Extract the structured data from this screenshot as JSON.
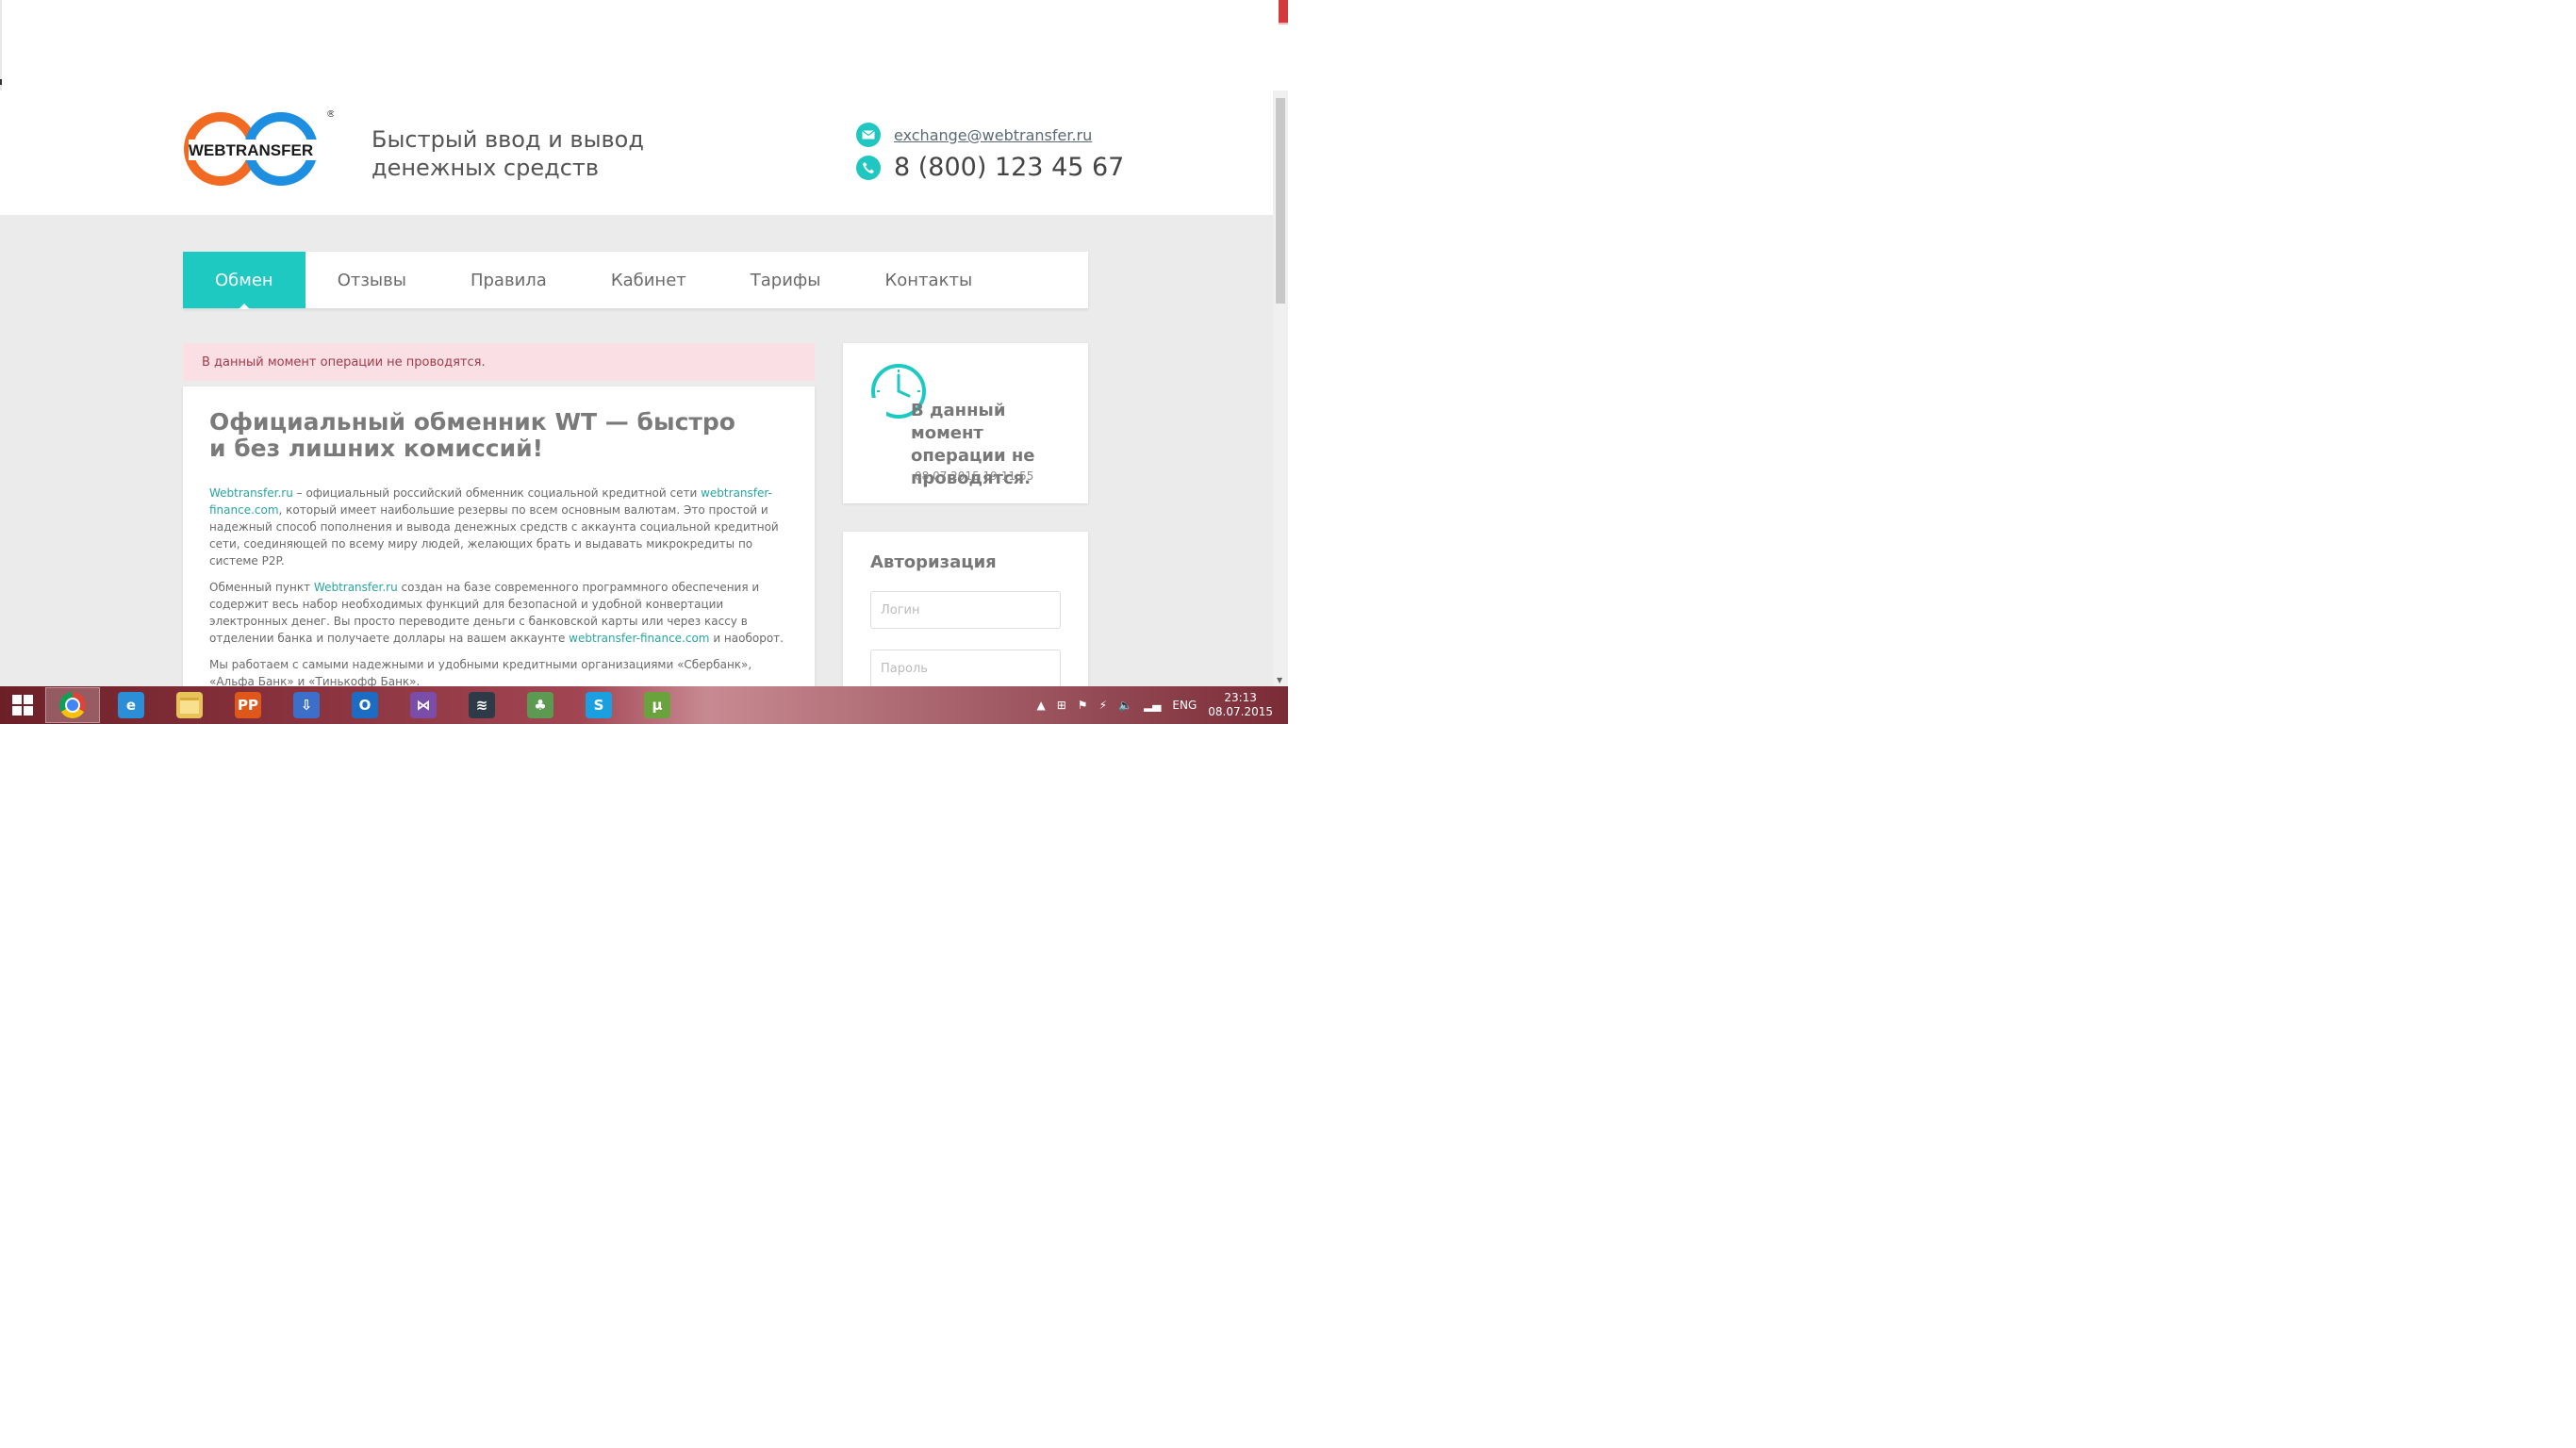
{
  "header": {
    "logo_text": "WEBTRANSFER",
    "tagline_line1": "Быстрый ввод и вывод",
    "tagline_line2": "денежных средств",
    "email": "exchange@webtransfer.ru",
    "phone": "8 (800) 123 45 67"
  },
  "nav": {
    "items": [
      {
        "label": "Обмен"
      },
      {
        "label": "Отзывы"
      },
      {
        "label": "Правила"
      },
      {
        "label": "Кабинет"
      },
      {
        "label": "Тарифы"
      },
      {
        "label": "Контакты"
      }
    ]
  },
  "alert": {
    "text": "В данный момент операции не проводятся."
  },
  "main": {
    "title": "Официальный обменник WT — быстро и без лишних комиссий!",
    "p1_link1": "Webtransfer.ru",
    "p1_text1": " – официальный российский обменник социальной кредитной сети ",
    "p1_link2": "webtransfer-finance.com",
    "p1_text2": ", который имеет наибольшие резервы по всем основным валютам. Это простой и надежный способ пополнения и вывода денежных средств с аккаунта социальной кредитной сети, соединяющей по всему миру людей, желающих брать и выдавать микрокредиты по системе P2P.",
    "p2_text1": "Обменный пункт ",
    "p2_link1": "Webtransfer.ru",
    "p2_text2": " создан на базе современного программного обеспечения и содержит весь набор необходимых функций для безопасной и удобной конвертации электронных денег. Вы просто переводите деньги с банковской карты или через кассу в отделении банка и получаете доллары на вашем аккаунте ",
    "p2_link2": "webtransfer-finance.com",
    "p2_text3": " и наоборот.",
    "p3_text": "Мы работаем с самыми надежными и удобными кредитными организациями «Сбербанк», «Альфа Банк» и «Тинькофф Банк»."
  },
  "status_card": {
    "text": "В данный момент операции не проводятся.",
    "timestamp": "08.07.2015 19:11:55"
  },
  "auth": {
    "title": "Авторизация",
    "login_placeholder": "Логин",
    "password_placeholder": "Пароль"
  },
  "taskbar": {
    "apps": [
      {
        "name": "chrome",
        "glyph": "",
        "color": "#e8b53a"
      },
      {
        "name": "internet-explorer",
        "glyph": "e",
        "color": "#2b8fd8"
      },
      {
        "name": "file-explorer",
        "glyph": "",
        "color": "#e7c35a"
      },
      {
        "name": "app-pp",
        "glyph": "PP",
        "color": "#e0571b"
      },
      {
        "name": "app-installer",
        "glyph": "⇩",
        "color": "#3b6fc9"
      },
      {
        "name": "outlook",
        "glyph": "O",
        "color": "#1b6cc2"
      },
      {
        "name": "visual-studio",
        "glyph": "⋈",
        "color": "#7a4ea8"
      },
      {
        "name": "network-app",
        "glyph": "≋",
        "color": "#2f3a48"
      },
      {
        "name": "app-people",
        "glyph": "♣",
        "color": "#5c9a52"
      },
      {
        "name": "skype",
        "glyph": "S",
        "color": "#1aa0e0"
      },
      {
        "name": "utorrent",
        "glyph": "µ",
        "color": "#6aa33b"
      }
    ],
    "language": "ENG",
    "time": "23:13",
    "date": "08.07.2015"
  }
}
